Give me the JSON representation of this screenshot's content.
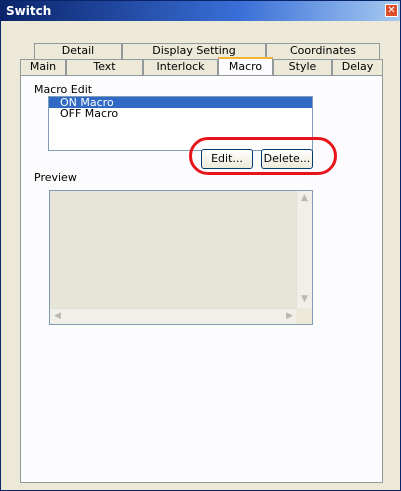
{
  "window": {
    "title": "Switch",
    "close_glyph": "✕"
  },
  "tabs_back": [
    "Detail",
    "Display Setting",
    "Coordinates"
  ],
  "tabs_front": [
    "Main",
    "Text",
    "Interlock",
    "Macro",
    "Style",
    "Delay"
  ],
  "active_tab": "Macro",
  "macro_edit": {
    "label": "Macro Edit",
    "items": [
      "ON Macro",
      "OFF Macro"
    ],
    "selected_index": 0,
    "edit_button": "Edit...",
    "delete_button": "Delete..."
  },
  "preview": {
    "label": "Preview"
  },
  "colors": {
    "highlight": "#e8141b",
    "selection": "#316ac5",
    "active_tab_accent": "#f4b33a"
  }
}
